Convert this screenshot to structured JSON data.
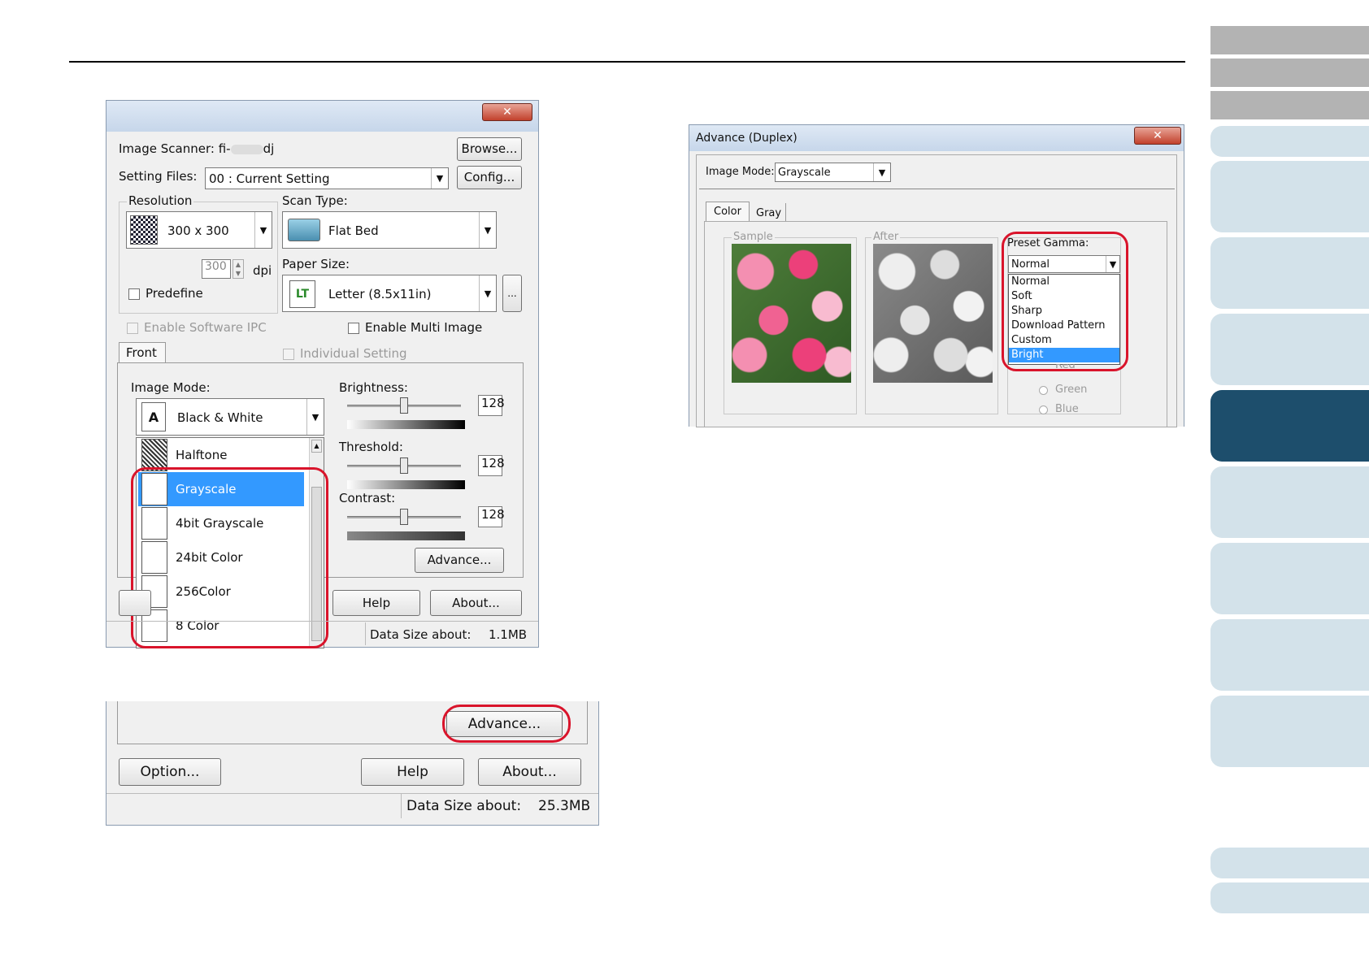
{
  "main_dialog": {
    "close_glyph": "✕",
    "image_scanner_label": "Image Scanner:",
    "image_scanner_value_prefix": "fi-",
    "image_scanner_value_suffix": "dj",
    "browse": "Browse...",
    "setting_files_label": "Setting Files:",
    "setting_files_value": "00 : Current Setting",
    "config": "Config...",
    "resolution_label": "Resolution",
    "resolution_value": "300 x 300",
    "dpi_value": "300",
    "dpi_unit": "dpi",
    "predefine": "Predefine",
    "scan_type_label": "Scan Type:",
    "scan_type_value": "Flat Bed",
    "paper_size_label": "Paper Size:",
    "paper_size_value": "Letter (8.5x11in)",
    "paper_size_more": "...",
    "enable_software_ipc": "Enable Software IPC",
    "enable_multi_image": "Enable Multi Image",
    "tab_front": "Front",
    "individual_setting": "Individual Setting",
    "image_mode_label": "Image Mode:",
    "image_mode_value": "Black & White",
    "image_mode_options": [
      "Halftone",
      "Grayscale",
      "4bit Grayscale",
      "24bit Color",
      "256Color",
      "8 Color"
    ],
    "selected_option": "Grayscale",
    "brightness_label": "Brightness:",
    "brightness_value": "128",
    "threshold_label": "Threshold:",
    "threshold_value": "128",
    "contrast_label": "Contrast:",
    "contrast_value": "128",
    "advance": "Advance...",
    "help": "Help",
    "about": "About...",
    "data_size_label": "Data Size about:",
    "data_size_value": "1.1MB"
  },
  "bottom_dialog": {
    "advance": "Advance...",
    "option": "Option...",
    "help": "Help",
    "about": "About...",
    "data_size_label": "Data Size about:",
    "data_size_value": "25.3MB"
  },
  "advance_dialog": {
    "title": "Advance (Duplex)",
    "close_glyph": "✕",
    "image_mode_label": "Image Mode:",
    "image_mode_value": "Grayscale",
    "tab_color": "Color",
    "tab_gray": "Gray",
    "sample_label": "Sample",
    "after_label": "After",
    "preset_gamma_label": "Preset Gamma:",
    "preset_gamma_value": "Normal",
    "gamma_options": [
      "Normal",
      "Soft",
      "Sharp",
      "Download Pattern",
      "Custom",
      "Bright"
    ],
    "gamma_selected": "Bright",
    "red": "Red",
    "green": "Green",
    "blue": "Blue"
  },
  "colors": {
    "highlight": "#d9142b",
    "selection": "#3399ff",
    "nav_active": "#1d4e6c",
    "nav_light": "#d3e2ea"
  }
}
